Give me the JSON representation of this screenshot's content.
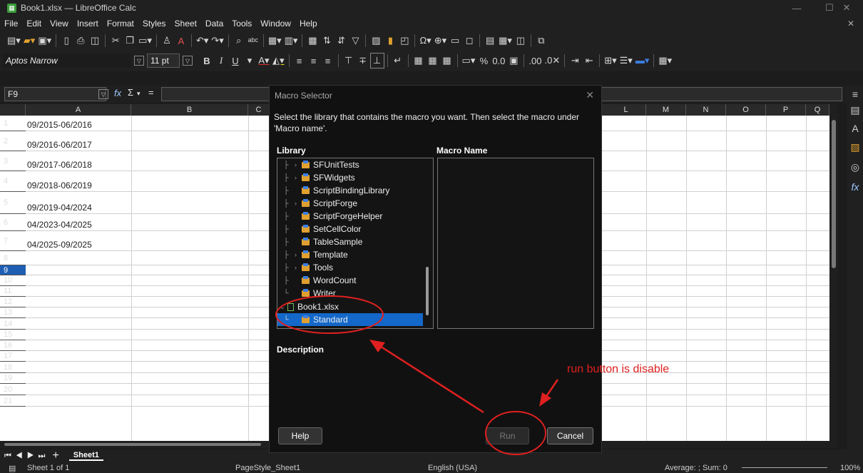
{
  "window": {
    "title": "Book1.xlsx — LibreOffice Calc",
    "minimize": "—",
    "maximize": "☐",
    "close": "✕"
  },
  "menu": [
    "File",
    "Edit",
    "View",
    "Insert",
    "Format",
    "Styles",
    "Sheet",
    "Data",
    "Tools",
    "Window",
    "Help"
  ],
  "menu_close": "✕",
  "format_bar": {
    "font_name": "Aptos Narrow",
    "font_size": "11 pt",
    "bold": "B",
    "italic": "I",
    "underline": "U",
    "percent": "%",
    "decimal": "0.0"
  },
  "formula_bar": {
    "cell_ref": "F9",
    "fx": "fx",
    "sigma": "Σ",
    "equals": "=",
    "expand": "▼"
  },
  "columns": [
    "A",
    "B",
    "C",
    "L",
    "M",
    "N",
    "O",
    "P",
    "Q"
  ],
  "rows": [
    "1",
    "2",
    "3",
    "4",
    "5",
    "6",
    "7",
    "8",
    "9",
    "10",
    "11",
    "12",
    "13",
    "14",
    "15",
    "16",
    "17",
    "18",
    "19",
    "20",
    "21"
  ],
  "selected_row": "9",
  "cells": [
    {
      "row": "1",
      "value": "09/2015-06/2016"
    },
    {
      "row": "2",
      "value": "09/2016-06/2017"
    },
    {
      "row": "3",
      "value": "09/2017-06/2018"
    },
    {
      "row": "4",
      "value": "09/2018-06/2019"
    },
    {
      "row": "5",
      "value": "09/2019-04/2024"
    },
    {
      "row": "6",
      "value": "04/2023-04/2025"
    },
    {
      "row": "7",
      "value": "04/2025-09/2025"
    }
  ],
  "sheet_tabs": {
    "add": "+",
    "active": "Sheet1"
  },
  "status": {
    "sheet": "Sheet 1 of 1",
    "page_style": "PageStyle_Sheet1",
    "language": "English (USA)",
    "summary": "Average: ; Sum: 0",
    "zoom": "100%"
  },
  "dialog": {
    "title": "Macro Selector",
    "close": "✕",
    "instruction": "Select the library that contains the macro you want. Then select the macro under 'Macro name'.",
    "library_header": "Library",
    "macro_name_header": "Macro Name",
    "description_header": "Description",
    "library_items": [
      {
        "label": "SFUnitTests",
        "expandable": true
      },
      {
        "label": "SFWidgets",
        "expandable": true
      },
      {
        "label": "ScriptBindingLibrary",
        "expandable": false
      },
      {
        "label": "ScriptForge",
        "expandable": true
      },
      {
        "label": "ScriptForgeHelper",
        "expandable": false
      },
      {
        "label": "SetCellColor",
        "expandable": false
      },
      {
        "label": "TableSample",
        "expandable": false
      },
      {
        "label": "Template",
        "expandable": true
      },
      {
        "label": "Tools",
        "expandable": true
      },
      {
        "label": "WordCount",
        "expandable": false
      },
      {
        "label": "Writer",
        "expandable": false
      }
    ],
    "document_node": "Book1.xlsx",
    "selected_library": "Standard",
    "buttons": {
      "help": "Help",
      "run": "Run",
      "cancel": "Cancel"
    }
  },
  "annotation": {
    "text": "run button is disable",
    "color": "#e02020"
  }
}
